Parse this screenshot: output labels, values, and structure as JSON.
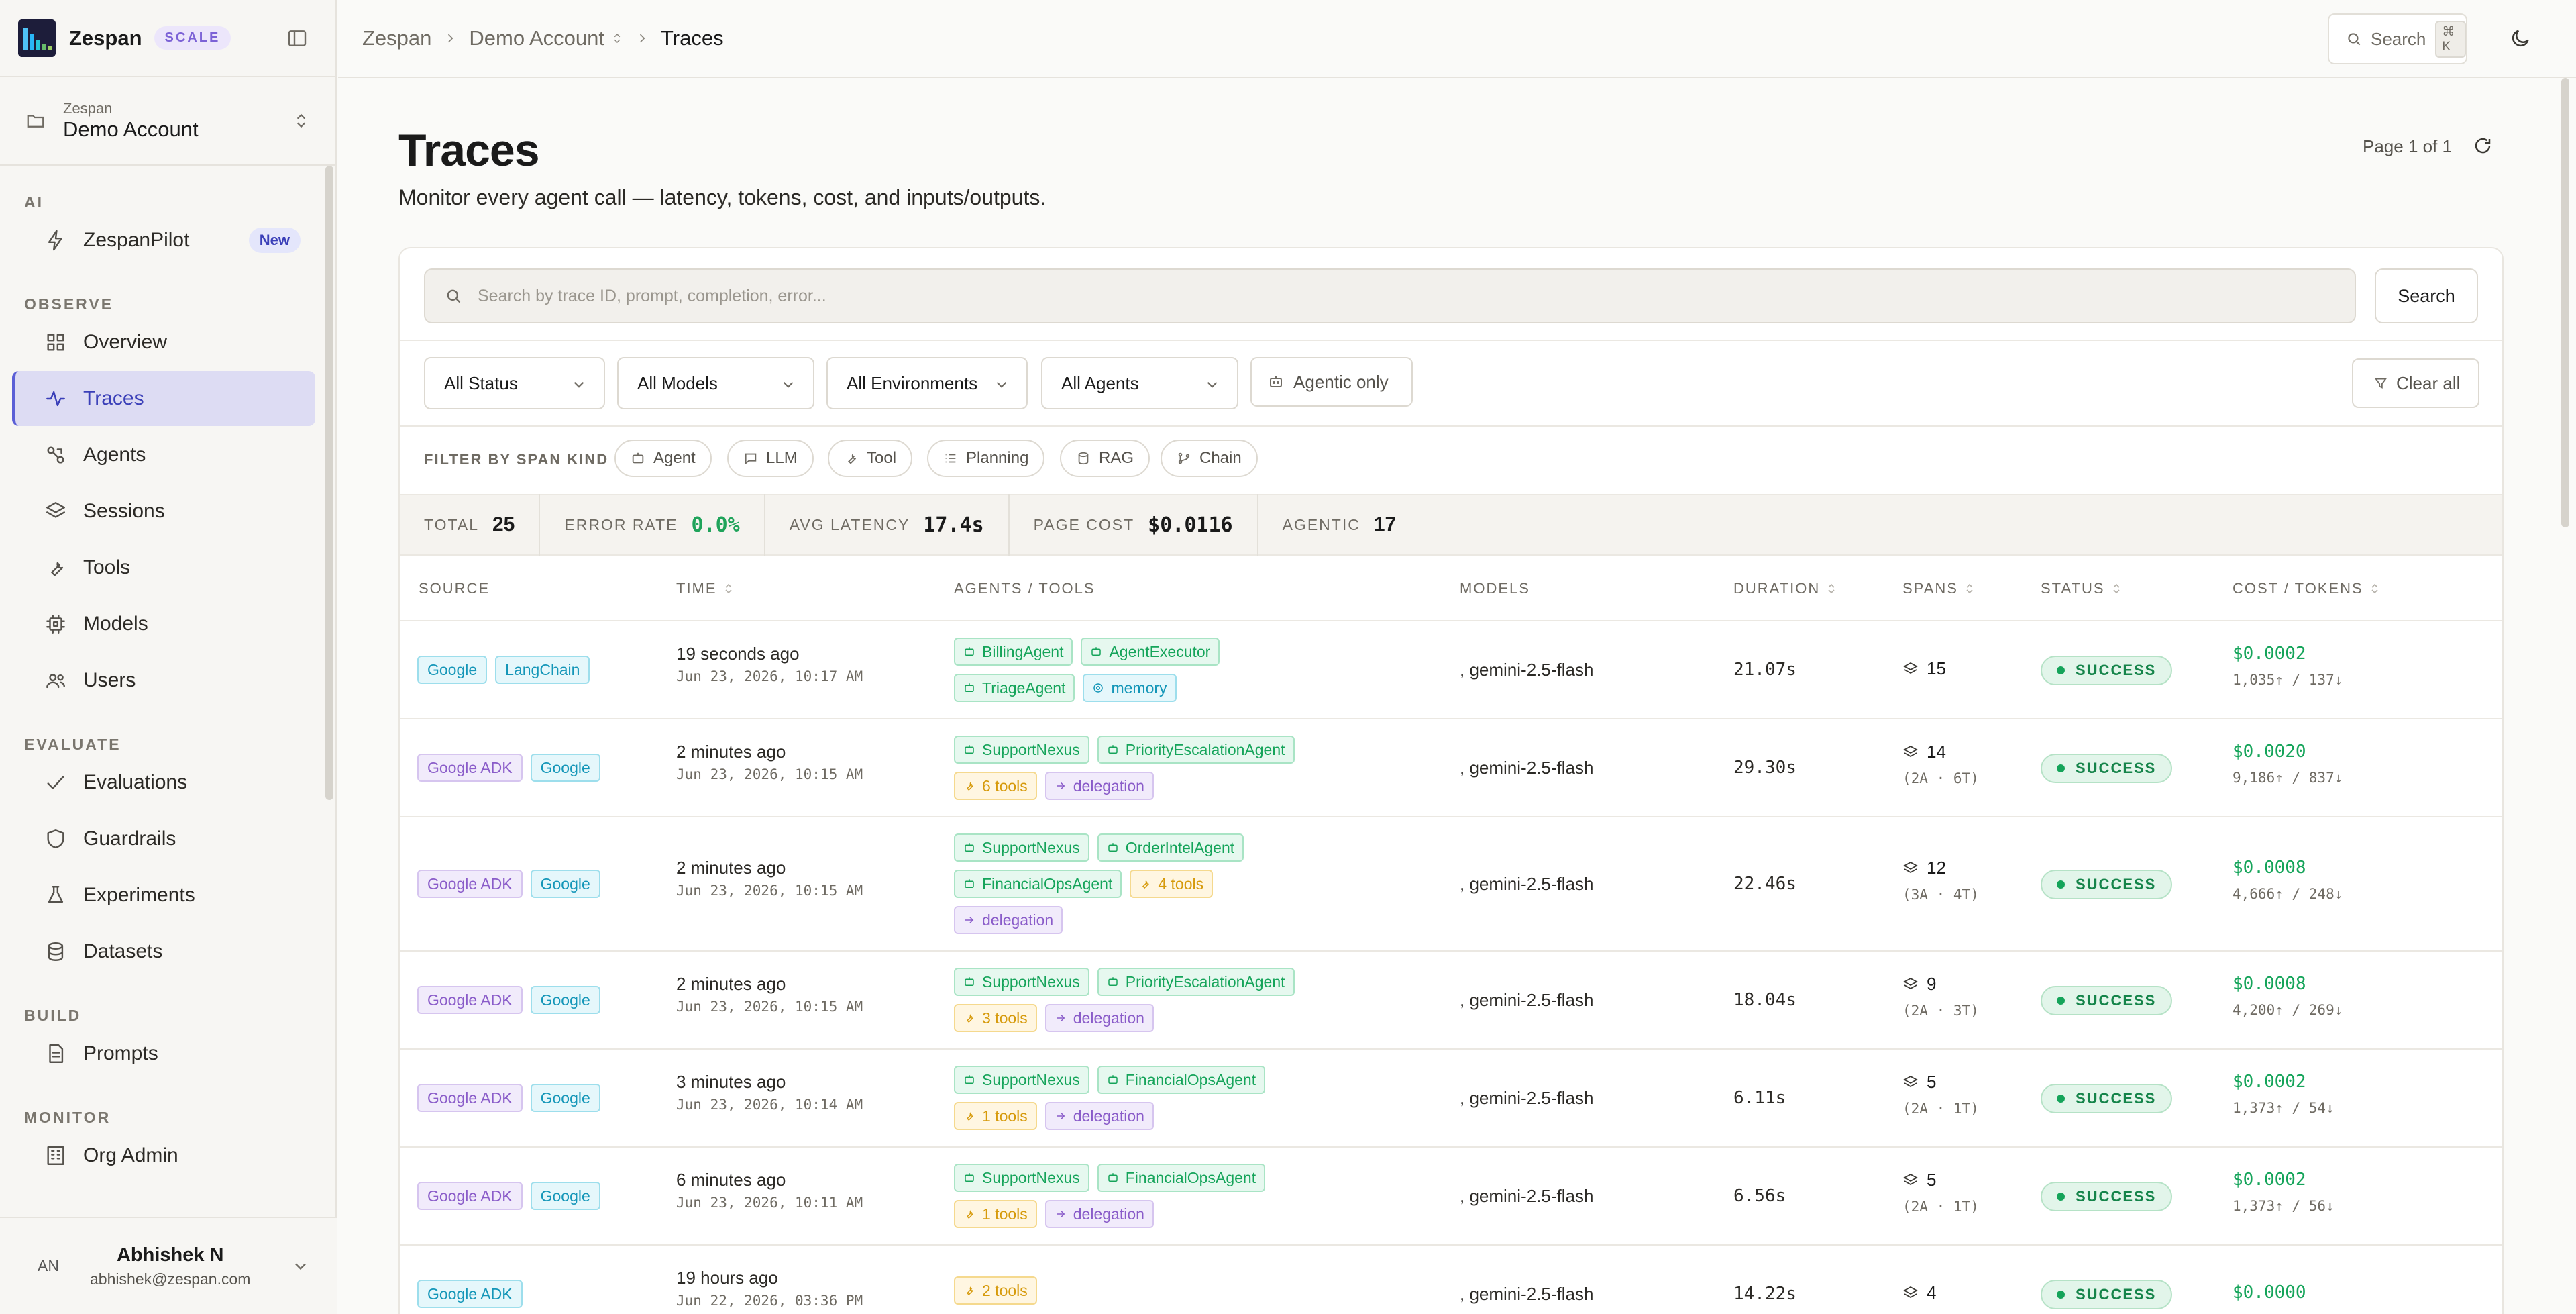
{
  "brand": {
    "name": "Zespan",
    "plan": "SCALE"
  },
  "account": {
    "org": "Zespan",
    "name": "Demo Account"
  },
  "sidebar": {
    "sections": [
      {
        "label": "AI",
        "items": [
          {
            "label": "ZespanPilot",
            "icon": "sparkle-icon",
            "badge": "New"
          }
        ]
      },
      {
        "label": "OBSERVE",
        "items": [
          {
            "label": "Overview",
            "icon": "grid-icon"
          },
          {
            "label": "Traces",
            "icon": "activity-icon",
            "active": true
          },
          {
            "label": "Agents",
            "icon": "agents-icon"
          },
          {
            "label": "Sessions",
            "icon": "layers-icon"
          },
          {
            "label": "Tools",
            "icon": "wrench-icon"
          },
          {
            "label": "Models",
            "icon": "cpu-icon"
          },
          {
            "label": "Users",
            "icon": "users-icon"
          }
        ]
      },
      {
        "label": "EVALUATE",
        "items": [
          {
            "label": "Evaluations",
            "icon": "check-icon"
          },
          {
            "label": "Guardrails",
            "icon": "shield-icon"
          },
          {
            "label": "Experiments",
            "icon": "flask-icon"
          },
          {
            "label": "Datasets",
            "icon": "database-icon"
          }
        ]
      },
      {
        "label": "BUILD",
        "items": [
          {
            "label": "Prompts",
            "icon": "document-icon"
          }
        ]
      },
      {
        "label": "MONITOR",
        "items": [
          {
            "label": "Org Admin",
            "icon": "building-icon"
          }
        ]
      }
    ]
  },
  "user": {
    "initials": "AN",
    "name": "Abhishek N",
    "email": "abhishek@zespan.com"
  },
  "breadcrumb": {
    "root": "Zespan",
    "account": "Demo Account",
    "current": "Traces"
  },
  "topbar": {
    "search_label": "Search",
    "shortcut": "⌘ K"
  },
  "header": {
    "title": "Traces",
    "subtitle": "Monitor every agent call — latency, tokens, cost, and inputs/outputs.",
    "pager": "Page 1 of 1"
  },
  "search": {
    "placeholder": "Search by trace ID, prompt, completion, error...",
    "button": "Search"
  },
  "filters": {
    "status": "All Status",
    "models": "All Models",
    "environments": "All Environments",
    "agents": "All Agents",
    "agentic_only": "Agentic only",
    "clear": "Clear all"
  },
  "span_kinds": {
    "label": "FILTER BY SPAN KIND",
    "chips": [
      "Agent",
      "LLM",
      "Tool",
      "Planning",
      "RAG",
      "Chain"
    ]
  },
  "stats": {
    "total_label": "TOTAL",
    "total": "25",
    "error_label": "ERROR RATE",
    "error": "0.0%",
    "latency_label": "AVG LATENCY",
    "latency": "17.4s",
    "cost_label": "PAGE COST",
    "cost": "$0.0116",
    "agentic_label": "AGENTIC",
    "agentic": "17"
  },
  "columns": {
    "source": "SOURCE",
    "time": "TIME",
    "agents": "AGENTS / TOOLS",
    "models": "MODELS",
    "duration": "DURATION",
    "spans": "SPANS",
    "status": "STATUS",
    "cost": "COST / TOKENS"
  },
  "rows": [
    {
      "sources": [
        [
          "Google",
          "google"
        ],
        [
          "LangChain",
          "lang"
        ]
      ],
      "time": "19 seconds ago",
      "date": "Jun 23, 2026, 10:17 AM",
      "tags": [
        [
          [
            "BillingAgent",
            "agent"
          ],
          [
            "AgentExecutor",
            "agent"
          ]
        ],
        [
          [
            "TriageAgent",
            "agent"
          ],
          [
            "memory",
            "mem"
          ]
        ]
      ],
      "model": ", gemini-2.5-flash",
      "duration": "21.07s",
      "spans": "15",
      "spans_detail": "",
      "status": "SUCCESS",
      "cost": "$0.0002",
      "tokens": "1,035↑ / 137↓"
    },
    {
      "sources": [
        [
          "Google ADK",
          "adk"
        ],
        [
          "Google",
          "google"
        ]
      ],
      "time": "2 minutes ago",
      "date": "Jun 23, 2026, 10:15 AM",
      "tags": [
        [
          [
            "SupportNexus",
            "agent"
          ],
          [
            "PriorityEscalationAgent",
            "agent"
          ]
        ],
        [
          [
            "6 tools",
            "tools"
          ],
          [
            "delegation",
            "deleg"
          ]
        ]
      ],
      "model": ", gemini-2.5-flash",
      "duration": "29.30s",
      "spans": "14",
      "spans_detail": "(2A · 6T)",
      "status": "SUCCESS",
      "cost": "$0.0020",
      "tokens": "9,186↑ / 837↓"
    },
    {
      "sources": [
        [
          "Google ADK",
          "adk"
        ],
        [
          "Google",
          "google"
        ]
      ],
      "time": "2 minutes ago",
      "date": "Jun 23, 2026, 10:15 AM",
      "tags": [
        [
          [
            "SupportNexus",
            "agent"
          ],
          [
            "OrderIntelAgent",
            "agent"
          ]
        ],
        [
          [
            "FinancialOpsAgent",
            "agent"
          ],
          [
            "4 tools",
            "tools"
          ]
        ],
        [
          [
            "delegation",
            "deleg"
          ]
        ]
      ],
      "model": ", gemini-2.5-flash",
      "duration": "22.46s",
      "spans": "12",
      "spans_detail": "(3A · 4T)",
      "status": "SUCCESS",
      "cost": "$0.0008",
      "tokens": "4,666↑ / 248↓"
    },
    {
      "sources": [
        [
          "Google ADK",
          "adk"
        ],
        [
          "Google",
          "google"
        ]
      ],
      "time": "2 minutes ago",
      "date": "Jun 23, 2026, 10:15 AM",
      "tags": [
        [
          [
            "SupportNexus",
            "agent"
          ],
          [
            "PriorityEscalationAgent",
            "agent"
          ]
        ],
        [
          [
            "3 tools",
            "tools"
          ],
          [
            "delegation",
            "deleg"
          ]
        ]
      ],
      "model": ", gemini-2.5-flash",
      "duration": "18.04s",
      "spans": "9",
      "spans_detail": "(2A · 3T)",
      "status": "SUCCESS",
      "cost": "$0.0008",
      "tokens": "4,200↑ / 269↓"
    },
    {
      "sources": [
        [
          "Google ADK",
          "adk"
        ],
        [
          "Google",
          "google"
        ]
      ],
      "time": "3 minutes ago",
      "date": "Jun 23, 2026, 10:14 AM",
      "tags": [
        [
          [
            "SupportNexus",
            "agent"
          ],
          [
            "FinancialOpsAgent",
            "agent"
          ]
        ],
        [
          [
            "1 tools",
            "tools"
          ],
          [
            "delegation",
            "deleg"
          ]
        ]
      ],
      "model": ", gemini-2.5-flash",
      "duration": "6.11s",
      "spans": "5",
      "spans_detail": "(2A · 1T)",
      "status": "SUCCESS",
      "cost": "$0.0002",
      "tokens": "1,373↑ / 54↓"
    },
    {
      "sources": [
        [
          "Google ADK",
          "adk"
        ],
        [
          "Google",
          "google"
        ]
      ],
      "time": "6 minutes ago",
      "date": "Jun 23, 2026, 10:11 AM",
      "tags": [
        [
          [
            "SupportNexus",
            "agent"
          ],
          [
            "FinancialOpsAgent",
            "agent"
          ]
        ],
        [
          [
            "1 tools",
            "tools"
          ],
          [
            "delegation",
            "deleg"
          ]
        ]
      ],
      "model": ", gemini-2.5-flash",
      "duration": "6.56s",
      "spans": "5",
      "spans_detail": "(2A · 1T)",
      "status": "SUCCESS",
      "cost": "$0.0002",
      "tokens": "1,373↑ / 56↓"
    },
    {
      "sources": [
        [
          "Google ADK",
          "google"
        ]
      ],
      "time": "19 hours ago",
      "date": "Jun 22, 2026, 03:36 PM",
      "tags": [
        [
          [
            "2 tools",
            "tools"
          ]
        ]
      ],
      "model": ", gemini-2.5-flash",
      "duration": "14.22s",
      "spans": "4",
      "spans_detail": "",
      "status": "SUCCESS",
      "cost": "$0.0000",
      "tokens": ""
    }
  ],
  "colors": {
    "accent": "#5b5fd6",
    "success": "#15a45a",
    "brand_dark": "#1d1d3a"
  }
}
